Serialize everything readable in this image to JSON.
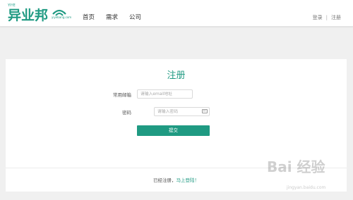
{
  "header": {
    "logo_small": "YIYE",
    "logo_text": "异业邦",
    "logo_sub": "yiyebang.com",
    "nav": [
      "首页",
      "需求",
      "公司"
    ],
    "login": "登录",
    "separator": "|",
    "register": "注册"
  },
  "form": {
    "title": "注册",
    "email_label": "常用邮箱",
    "email_placeholder": "请输入email地址",
    "password_label": "密码",
    "password_placeholder": "请输入密码",
    "submit_label": "提交"
  },
  "footer": {
    "prompt": "已经注册，",
    "link": "马上登陆！"
  },
  "watermark": {
    "text": "Bai 经验",
    "sub": "jingyan.baidu.com"
  },
  "colors": {
    "brand": "#1f9a82",
    "background": "#f0f0f0"
  }
}
